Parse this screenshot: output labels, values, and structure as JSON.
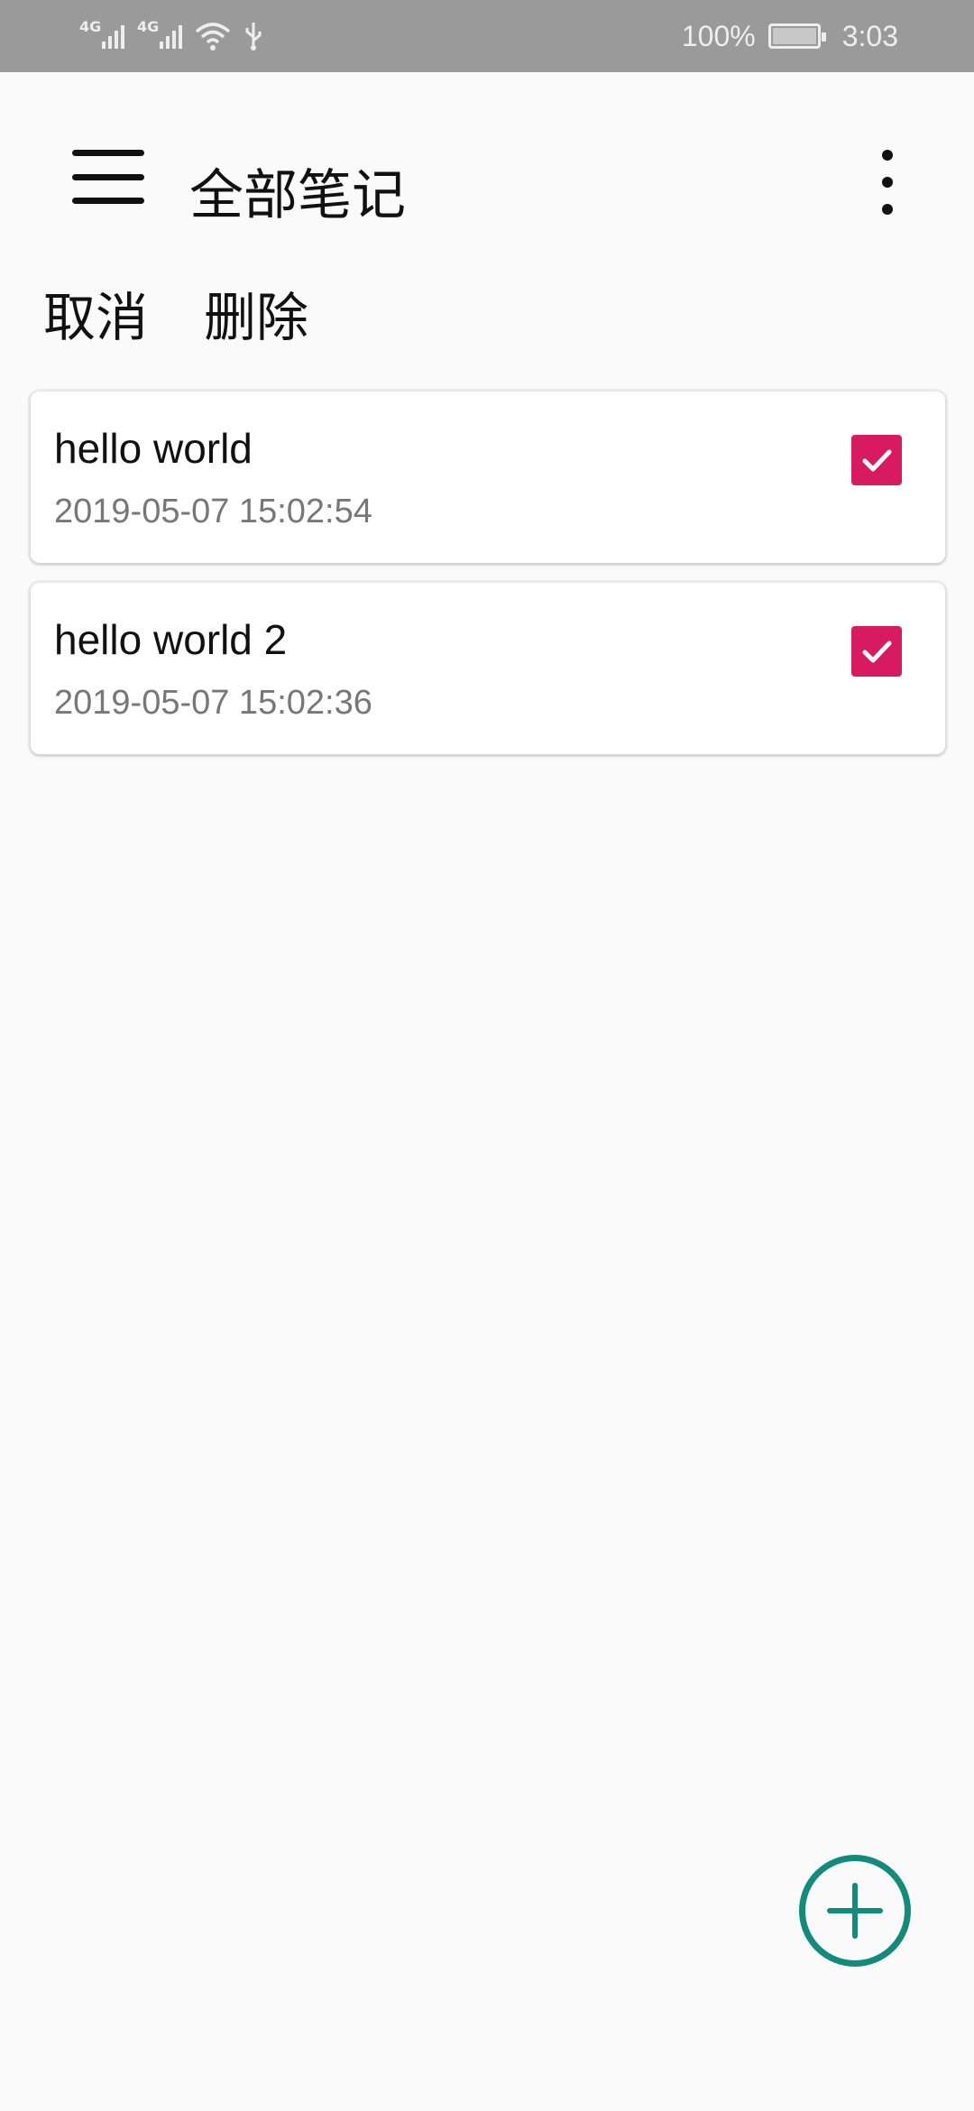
{
  "status_bar": {
    "network_left": "4G",
    "network_right": "4G",
    "battery_text": "100%",
    "time": "3:03"
  },
  "toolbar": {
    "title": "全部笔记",
    "menu_icon": "hamburger-menu-icon",
    "more_icon": "more-vert-icon"
  },
  "actions": {
    "cancel_label": "取消",
    "delete_label": "删除"
  },
  "notes": [
    {
      "title": "hello world",
      "time": "2019-05-07 15:02:54",
      "checked": true
    },
    {
      "title": "hello world 2",
      "time": "2019-05-07 15:02:36",
      "checked": true
    }
  ],
  "colors": {
    "status_bar": "#9a9a9a",
    "checkbox": "#d81b60",
    "fab": "#128b7c",
    "background": "#fafafa"
  }
}
